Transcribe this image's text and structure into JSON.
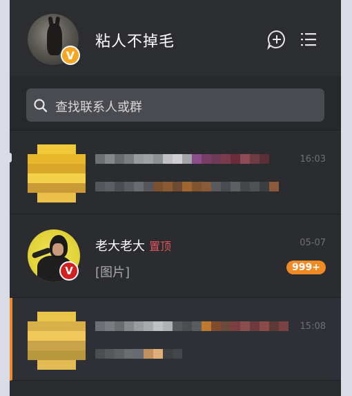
{
  "header": {
    "username": "粘人不掉毛",
    "avatar_badge": "V",
    "icons": [
      "new-chat-icon",
      "menu-list-icon"
    ]
  },
  "search": {
    "placeholder": "查找联系人或群"
  },
  "conversations": [
    {
      "time": "16:03"
    },
    {
      "name": "老大老大",
      "tag": "置顶",
      "preview": "[图片]",
      "time": "05-07",
      "unread": "999+",
      "badge": "V"
    },
    {
      "time": "15:08"
    }
  ],
  "colors": {
    "accent": "#ef8a2e",
    "pinned": "#e0545b",
    "unread_bg": "#f08a24",
    "badge_gold": "#f5a623",
    "badge_red": "#d21f1f"
  }
}
